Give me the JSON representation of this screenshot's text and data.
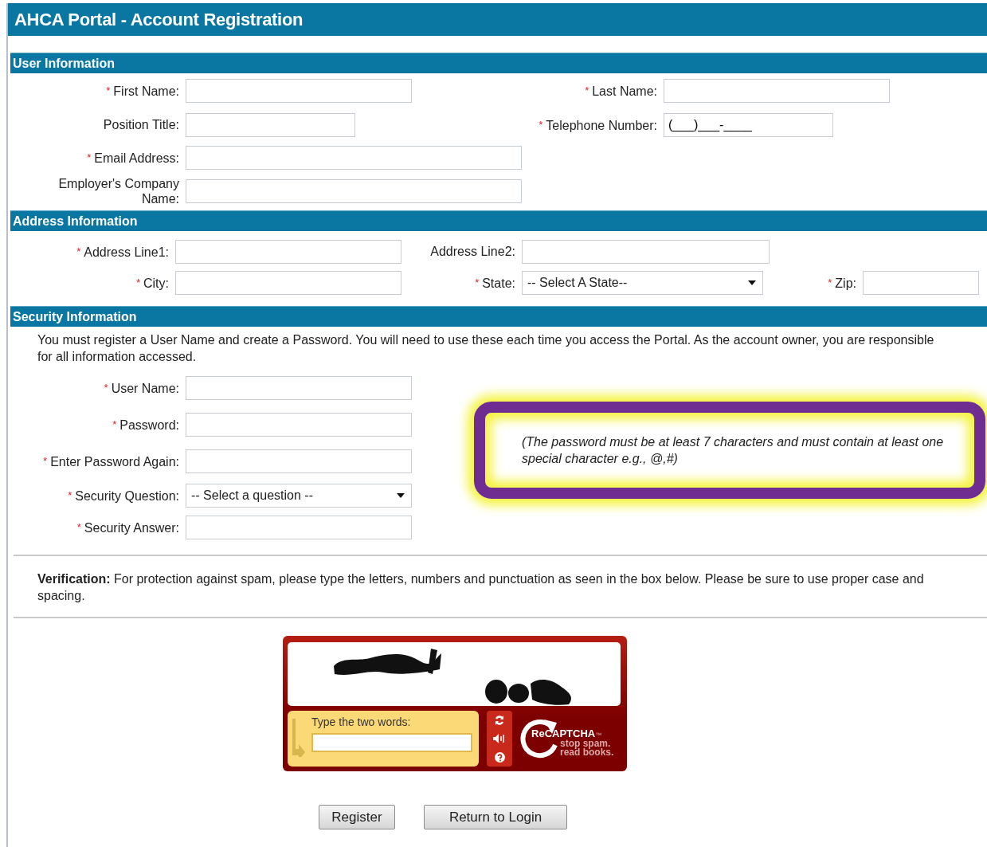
{
  "window": {
    "title": "AHCA Portal - Account Registration"
  },
  "user_information": {
    "heading": "User Information",
    "rows": [
      {
        "left": {
          "label": "First Name:",
          "required_mark": "*",
          "kind": "input"
        },
        "right": {
          "label": "Last Name:",
          "required_mark": "*",
          "kind": "input"
        }
      },
      {
        "left": {
          "label": "Position Title:",
          "kind": "input"
        },
        "right": {
          "label": "Telephone Number:",
          "required_mark": "*",
          "kind": "input",
          "value": "(___)___-____"
        }
      },
      {
        "left": {
          "label": "Email Address:",
          "required_mark": "*",
          "kind": "input"
        }
      },
      {
        "left": {
          "label": "Employer's Company Name:",
          "kind": "input"
        }
      }
    ]
  },
  "address_information": {
    "heading": "Address Information",
    "rows": [
      [
        {
          "label": "Address Line1:",
          "required_mark": "*",
          "kind": "input"
        },
        {
          "label": "Address Line2:",
          "kind": "input"
        }
      ],
      [
        {
          "label": "City:",
          "required_mark": "*",
          "kind": "input"
        },
        {
          "label": "State:",
          "required_mark": "*",
          "kind": "select",
          "value": "-- Select A State--"
        },
        {
          "label": "Zip:",
          "required_mark": "*",
          "kind": "input"
        }
      ]
    ]
  },
  "security_information": {
    "heading": "Security Information",
    "intro": "You must register a User Name and create a Password. You will need to use these each time you access the Portal. As the account owner, you are responsible for all information accessed.",
    "fields": [
      {
        "label": "User Name:",
        "required_mark": "*",
        "kind": "input"
      },
      {
        "label": "Password:",
        "required_mark": "*",
        "kind": "input"
      },
      {
        "label": "Enter Password Again:",
        "required_mark": "*",
        "kind": "input"
      },
      {
        "label": "Security Question:",
        "required_mark": "*",
        "kind": "select",
        "value": "-- Select a question --"
      },
      {
        "label": "Security Answer:",
        "required_mark": "*",
        "kind": "input"
      }
    ],
    "password_note": {
      "text": "(The password must be at least 7 characters and must contain at least one special character e.g., @,#)",
      "highlighted": true
    }
  },
  "verification": {
    "text": "**Verification:** For protection against spam, please type the letters, numbers and punctuation as seen in the box below. Please be sure to use proper case and spacing."
  },
  "captcha": {
    "prompt": "Type the two words:",
    "logo_prefix": "Re",
    "logo_name": "CAPTCHA",
    "logo_tm": "™",
    "tagline_1": "stop spam.",
    "tagline_2": "read books."
  },
  "buttons": [
    "Register",
    "Return to Login"
  ]
}
